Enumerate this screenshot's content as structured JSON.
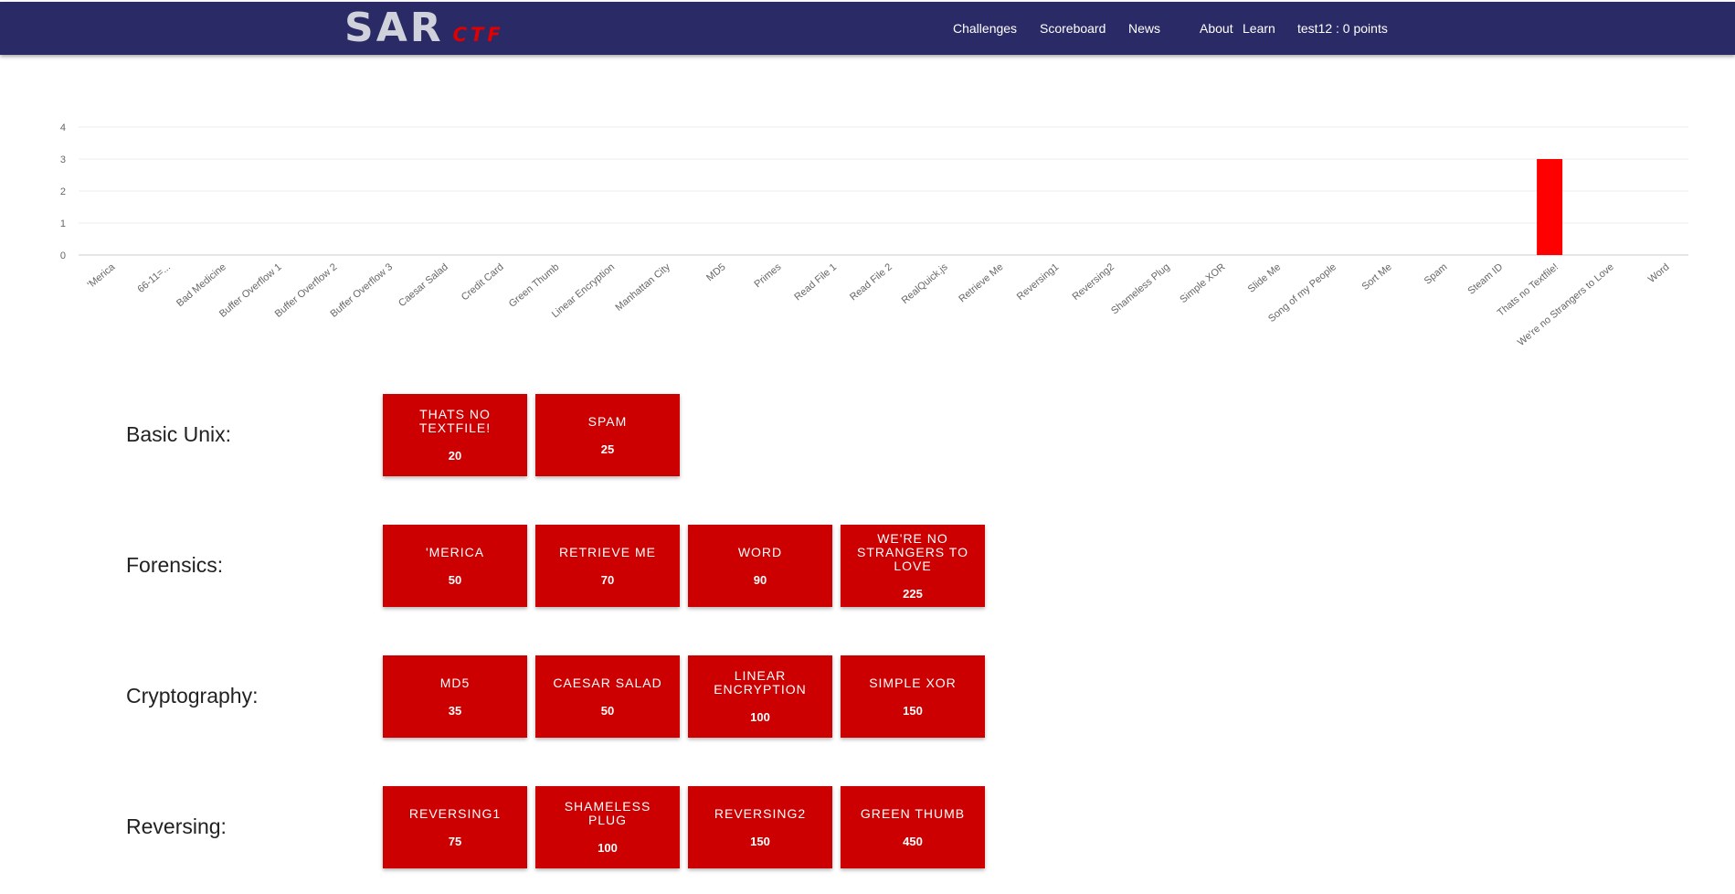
{
  "nav": {
    "logo_main": "SAR",
    "logo_sub": "CTF",
    "links": [
      "Challenges",
      "Scoreboard",
      "News",
      "About",
      "Learn"
    ],
    "user": "test12 : 0 points"
  },
  "chart_data": {
    "type": "bar",
    "categories": [
      "'Merica",
      "66-11=...",
      "Bad Medicine",
      "Buffer Overflow 1",
      "Buffer Overflow 2",
      "Buffer Overflow 3",
      "Caesar Salad",
      "Credit Card",
      "Green Thumb",
      "Linear Encryption",
      "Manhattan City",
      "MD5",
      "Primes",
      "Read File 1",
      "Read File 2",
      "RealQuick.js",
      "Retrieve Me",
      "Reversing1",
      "Reversing2",
      "Shameless Plug",
      "Simple XOR",
      "Slide Me",
      "Song of my People",
      "Sort Me",
      "Spam",
      "Steam ID",
      "Thats no Textfile!",
      "We're no Strangers to Love",
      "Word"
    ],
    "values": [
      0,
      0,
      0,
      0,
      0,
      0,
      0,
      0,
      0,
      0,
      0,
      0,
      0,
      0,
      0,
      0,
      0,
      0,
      0,
      0,
      0,
      0,
      0,
      0,
      0,
      0,
      3,
      0,
      0
    ],
    "yticks": [
      0,
      1,
      2,
      3,
      4
    ],
    "ylim": [
      0,
      4
    ],
    "bar_color": "#ff0000",
    "grid": true
  },
  "categories": [
    {
      "name": "Basic Unix:",
      "challenges": [
        {
          "name": "Thats no Textfile!",
          "points": "20"
        },
        {
          "name": "Spam",
          "points": "25"
        }
      ]
    },
    {
      "name": "Forensics:",
      "challenges": [
        {
          "name": "'Merica",
          "points": "50"
        },
        {
          "name": "Retrieve Me",
          "points": "70"
        },
        {
          "name": "Word",
          "points": "90"
        },
        {
          "name": "We're no Strangers to Love",
          "points": "225"
        }
      ]
    },
    {
      "name": "Cryptography:",
      "challenges": [
        {
          "name": "MD5",
          "points": "35"
        },
        {
          "name": "Caesar Salad",
          "points": "50"
        },
        {
          "name": "Linear Encryption",
          "points": "100"
        },
        {
          "name": "Simple XOR",
          "points": "150"
        }
      ]
    },
    {
      "name": "Reversing:",
      "challenges": [
        {
          "name": "Reversing1",
          "points": "75"
        },
        {
          "name": "Shameless Plug",
          "points": "100"
        },
        {
          "name": "Reversing2",
          "points": "150"
        },
        {
          "name": "Green Thumb",
          "points": "450"
        }
      ]
    }
  ],
  "colors": {
    "navbar": "#2a2a66",
    "tile": "#cc0000",
    "accent": "#e00000"
  }
}
